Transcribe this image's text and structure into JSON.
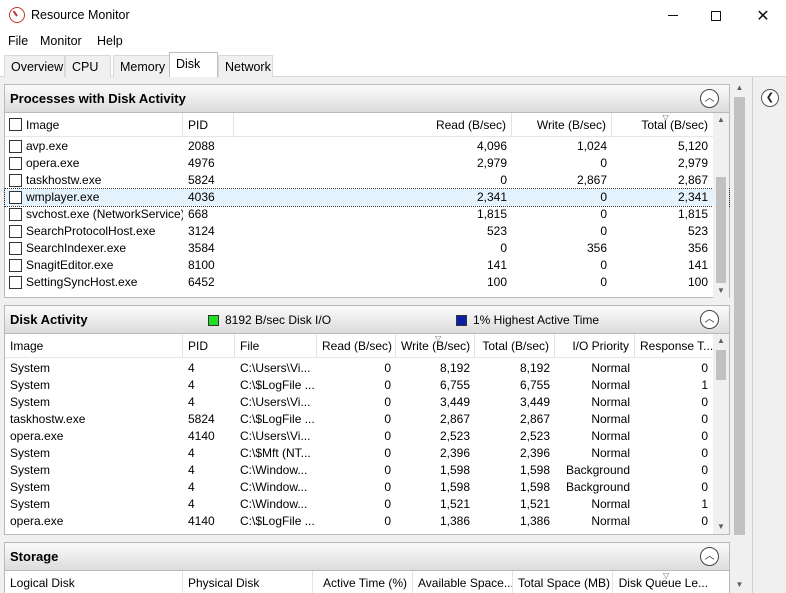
{
  "window": {
    "title": "Resource Monitor",
    "controls": {
      "minimize": "minimize",
      "maximize": "maximize",
      "close": "✕"
    }
  },
  "menu": [
    "File",
    "Monitor",
    "Help"
  ],
  "tabs": [
    {
      "label": "Overview",
      "active": false
    },
    {
      "label": "CPU",
      "active": false
    },
    {
      "label": "Memory",
      "active": false
    },
    {
      "label": "Disk",
      "active": true
    },
    {
      "label": "Network",
      "active": false
    }
  ],
  "processes": {
    "title": "Processes with Disk Activity",
    "columns": [
      "Image",
      "PID",
      "Read (B/sec)",
      "Write (B/sec)",
      "Total (B/sec)"
    ],
    "rows": [
      [
        "avp.exe",
        "2088",
        "4,096",
        "1,024",
        "5,120"
      ],
      [
        "opera.exe",
        "4976",
        "2,979",
        "0",
        "2,979"
      ],
      [
        "taskhostw.exe",
        "5824",
        "0",
        "2,867",
        "2,867"
      ],
      [
        "wmplayer.exe",
        "4036",
        "2,341",
        "0",
        "2,341"
      ],
      [
        "svchost.exe (NetworkService)",
        "668",
        "1,815",
        "0",
        "1,815"
      ],
      [
        "SearchProtocolHost.exe",
        "3124",
        "523",
        "0",
        "523"
      ],
      [
        "SearchIndexer.exe",
        "3584",
        "0",
        "356",
        "356"
      ],
      [
        "SnagitEditor.exe",
        "8100",
        "141",
        "0",
        "141"
      ],
      [
        "SettingSyncHost.exe",
        "6452",
        "100",
        "0",
        "100"
      ]
    ],
    "selected_index": 3
  },
  "disk_activity": {
    "title": "Disk Activity",
    "legend_io": "8192 B/sec Disk I/O",
    "legend_active": "1% Highest Active Time",
    "legend_io_color": "#22dd22",
    "legend_active_color": "#0b1ea8",
    "columns": [
      "Image",
      "PID",
      "File",
      "Read (B/sec)",
      "Write (B/sec)",
      "Total (B/sec)",
      "I/O Priority",
      "Response T..."
    ],
    "rows": [
      [
        "System",
        "4",
        "C:\\Users\\Vi...",
        "0",
        "8,192",
        "8,192",
        "Normal",
        "0"
      ],
      [
        "System",
        "4",
        "C:\\$LogFile ...",
        "0",
        "6,755",
        "6,755",
        "Normal",
        "1"
      ],
      [
        "System",
        "4",
        "C:\\Users\\Vi...",
        "0",
        "3,449",
        "3,449",
        "Normal",
        "0"
      ],
      [
        "taskhostw.exe",
        "5824",
        "C:\\$LogFile ...",
        "0",
        "2,867",
        "2,867",
        "Normal",
        "0"
      ],
      [
        "opera.exe",
        "4140",
        "C:\\Users\\Vi...",
        "0",
        "2,523",
        "2,523",
        "Normal",
        "0"
      ],
      [
        "System",
        "4",
        "C:\\$Mft (NT...",
        "0",
        "2,396",
        "2,396",
        "Normal",
        "0"
      ],
      [
        "System",
        "4",
        "C:\\Window...",
        "0",
        "1,598",
        "1,598",
        "Background",
        "0"
      ],
      [
        "System",
        "4",
        "C:\\Window...",
        "0",
        "1,598",
        "1,598",
        "Background",
        "0"
      ],
      [
        "System",
        "4",
        "C:\\Window...",
        "0",
        "1,521",
        "1,521",
        "Normal",
        "1"
      ],
      [
        "opera.exe",
        "4140",
        "C:\\$LogFile ...",
        "0",
        "1,386",
        "1,386",
        "Normal",
        "0"
      ]
    ]
  },
  "storage": {
    "title": "Storage",
    "columns": [
      "Logical Disk",
      "Physical Disk",
      "Active Time (%)",
      "Available Space...",
      "Total Space (MB)",
      "Disk Queue Le..."
    ]
  }
}
